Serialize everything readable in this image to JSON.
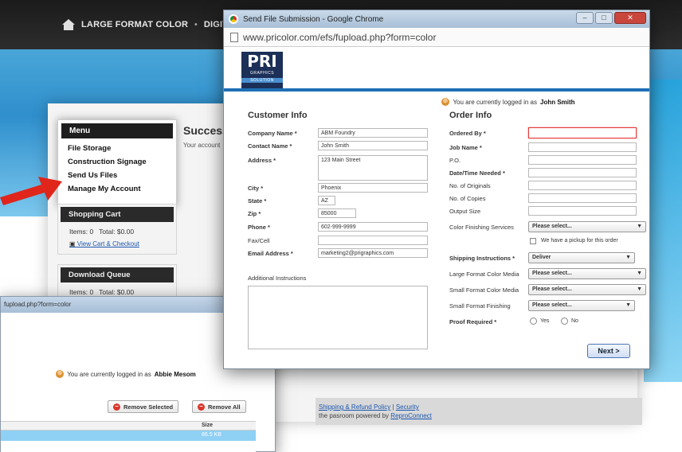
{
  "background_site": {
    "nav": [
      "LARGE FORMAT COLOR",
      "DIGITAL PRINTING"
    ],
    "nav_sep": "•",
    "menu": {
      "title": "Menu",
      "items": [
        "File Storage",
        "Construction Signage",
        "Send Us Files",
        "Manage My Account"
      ]
    },
    "success_title": "Success",
    "success_sub": "Your account",
    "shopping_cart": {
      "title": "Shopping Cart",
      "items_text": "Items: 0",
      "total_text": "Total: $0.00",
      "link": "View Cart & Checkout"
    },
    "download_queue": {
      "title": "Download Queue",
      "items_text": "Items: 0",
      "total_text": "Total: $0.00"
    },
    "footer": {
      "line1_link1": "Shipping & Refund Policy",
      "line1_sep": "|",
      "line1_link2": "Security",
      "line2_prefix": "the pasroom powered by",
      "line2_link": "ReproConnect"
    }
  },
  "popup": {
    "window_title": "Send File Submission - Google Chrome",
    "url": "www.pricolor.com/efs/fupload.php?form=color",
    "logo": {
      "big": "PRI",
      "small": "GRAPHICS",
      "tag": "SOLUTION"
    },
    "login": {
      "prefix": "You are currently logged in as",
      "user": "John Smith"
    },
    "customer_info": {
      "heading": "Customer Info",
      "company_label": "Company Name *",
      "company_value": "ABM Foundry",
      "contact_label": "Contact Name *",
      "contact_value": "John Smith",
      "address_label": "Address *",
      "address_value": "123 Main Street",
      "city_label": "City *",
      "city_value": "Phoenix",
      "state_label": "State *",
      "state_value": "AZ",
      "zip_label": "Zip *",
      "zip_value": "85000",
      "phone_label": "Phone *",
      "phone_value": "602-999-9999",
      "fax_label": "Fax/Cell",
      "fax_value": "",
      "email_label": "Email Address *",
      "email_value": "marketing2@prigraphics.com",
      "instructions_label": "Additional Instructions"
    },
    "order_info": {
      "heading": "Order Info",
      "ordered_by_label": "Ordered By *",
      "job_name_label": "Job Name *",
      "po_label": "P.O.",
      "date_needed_label": "Date/Time Needed *",
      "originals_label": "No. of Originals",
      "copies_label": "No. of Copies",
      "output_size_label": "Output Size",
      "finishing_label": "Color Finishing Services",
      "finishing_value": "Please select...",
      "pickup_text": "We have a pickup for this order",
      "shipping_label": "Shipping Instructions *",
      "shipping_value": "Deliver",
      "large_media_label": "Large Format Color Media",
      "large_media_value": "Please select...",
      "small_media_label": "Small Format Color Media",
      "small_media_value": "Please select...",
      "small_finishing_label": "Small Format Finishing",
      "small_finishing_value": "Please select...",
      "proof_label": "Proof Required *",
      "proof_yes": "Yes",
      "proof_no": "No"
    },
    "next_label": "Next >"
  },
  "second_window": {
    "url_fragment": "fupload.php?form=color",
    "login": {
      "prefix": "You are currently logged in as",
      "user": "Abbie Mesom"
    },
    "remove_selected": "Remove Selected",
    "remove_all": "Remove All",
    "size_header": "Size",
    "row_size": "86.5 KB"
  },
  "colors": {
    "accent_blue": "#1f6fb6",
    "required_red": "#e23a3a",
    "arrow_red": "#e0251b",
    "selected_row": "#8fd0f5"
  }
}
